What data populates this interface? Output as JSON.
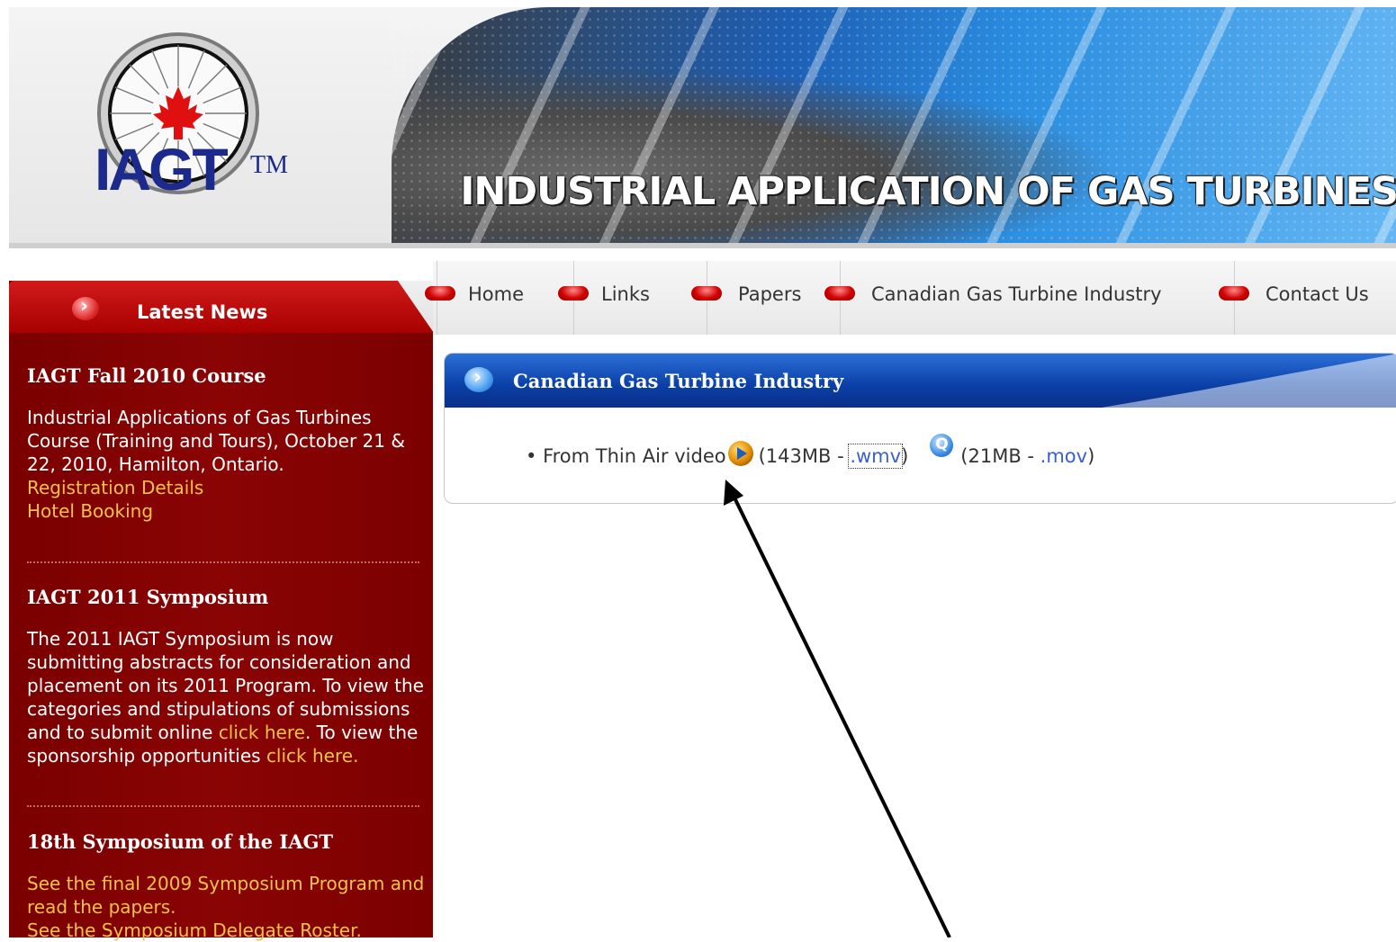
{
  "header": {
    "logo_text": "IAGT",
    "logo_tm": "TM",
    "banner_title": "INDUSTRIAL APPLICATION OF GAS TURBINES"
  },
  "nav": {
    "items": [
      {
        "label": "Home"
      },
      {
        "label": "Links"
      },
      {
        "label": "Papers"
      },
      {
        "label": "Canadian Gas Turbine Industry"
      },
      {
        "label": "Contact Us"
      }
    ]
  },
  "sidebar": {
    "tab_label": "Latest News",
    "news": [
      {
        "title": "IAGT Fall 2010 Course",
        "body": "Industrial Applications of Gas Turbines Course (Training and Tours), October 21 & 22, 2010, Hamilton, Ontario.",
        "links": [
          "Registration Details",
          "Hotel Booking"
        ]
      },
      {
        "title": "IAGT 2011 Symposium",
        "body_1": "The 2011 IAGT Symposium is now submitting abstracts for consideration and placement on its 2011 Program. To view the categories and stipulations of submissions and to submit online ",
        "link_1": "click here",
        "body_2": ". To view the sponsorship opportunities ",
        "link_2": "click here",
        "body_3": "."
      },
      {
        "title": "18th Symposium of the IAGT",
        "links": [
          "See the final 2009 Symposium Program and read the papers.",
          "See the Symposium Delegate Roster."
        ]
      }
    ]
  },
  "panel": {
    "title": "Canadian Gas Turbine Industry",
    "video_label": "From Thin Air video",
    "wmv_size_prefix": "(143MB - ",
    "wmv_link": ".wmv",
    "wmv_suffix": ")",
    "mov_size_prefix": "(21MB - ",
    "mov_link": ".mov",
    "mov_suffix": ")"
  },
  "icons": {
    "play": "windows-media-play-icon",
    "quicktime": "quicktime-icon"
  }
}
